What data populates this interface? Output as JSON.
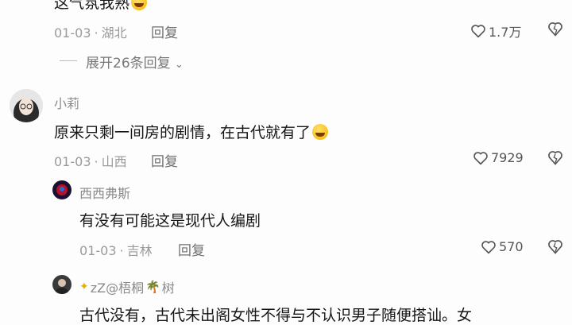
{
  "top_comment": {
    "text": "这气氛我熟",
    "date": "01-03",
    "location": "湖北",
    "reply_label": "回复",
    "likes": "1.7万"
  },
  "expand": {
    "label": "展开26条回复"
  },
  "comment2": {
    "username": "小莉",
    "text": "原来只剩一间房的剧情，在古代就有了",
    "date": "01-03",
    "location": "山西",
    "reply_label": "回复",
    "likes": "7929"
  },
  "reply1": {
    "username": "西西弗斯",
    "text": "有没有可能这是现代人编剧",
    "date": "01-03",
    "location": "吉林",
    "reply_label": "回复",
    "likes": "570"
  },
  "reply2": {
    "username": "zZ@梧桐",
    "username_suffix": "树",
    "text": "古代没有，古代未出阁女性不得与不认识男子随便搭讪。女"
  },
  "separator": "·"
}
